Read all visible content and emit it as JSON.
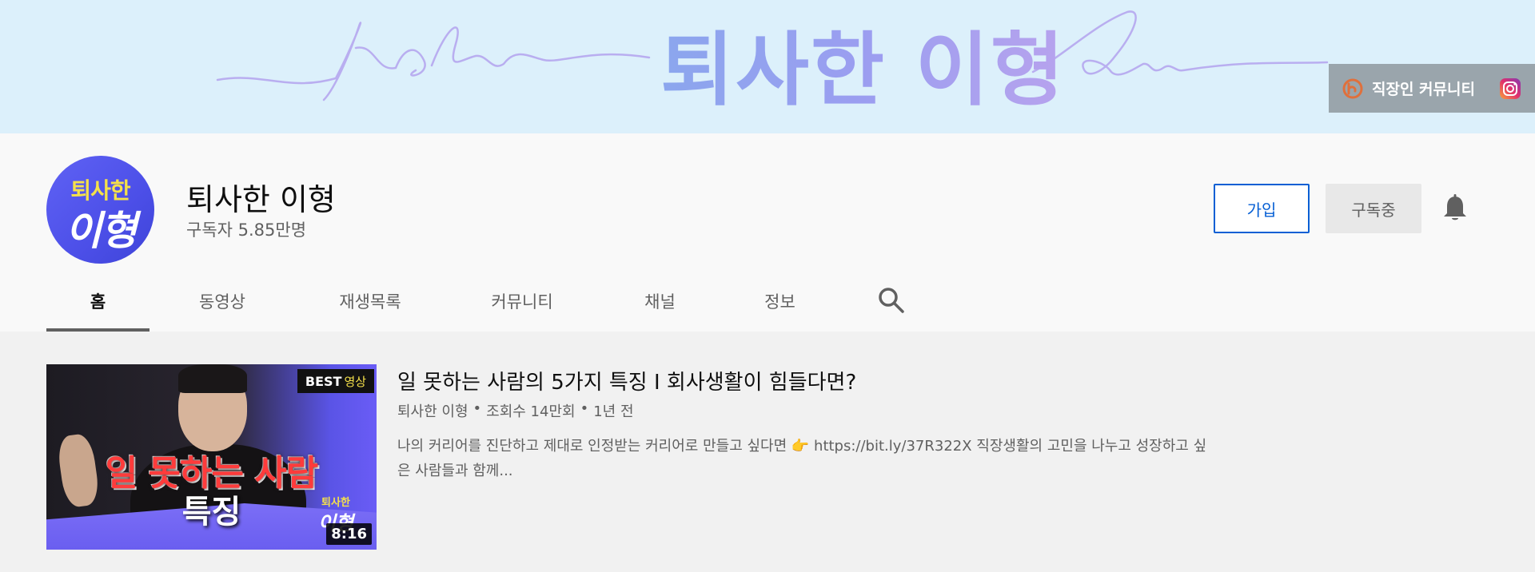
{
  "banner": {
    "script_left": "joshua",
    "title": "퇴사한 이형",
    "script_right": "lee",
    "link_label": "직장인 커뮤니티",
    "link_icon": "community-link-icon",
    "social_icon": "instagram-icon"
  },
  "channel": {
    "avatar_top": "퇴사한",
    "avatar_bottom": "이형",
    "name": "퇴사한 이형",
    "subscribers": "구독자 5.85만명",
    "join_label": "가입",
    "subscribed_label": "구독중"
  },
  "tabs": [
    {
      "label": "홈",
      "active": true
    },
    {
      "label": "동영상"
    },
    {
      "label": "재생목록"
    },
    {
      "label": "커뮤니티"
    },
    {
      "label": "채널"
    },
    {
      "label": "정보"
    }
  ],
  "featured": {
    "badge_best": "BEST",
    "badge_video": "영상",
    "thumb_line1": "일 못하는 사람",
    "thumb_line2": "특징",
    "thumb_logo_top": "퇴사한",
    "thumb_logo_bottom": "이형",
    "duration": "8:16",
    "title": "일 못하는 사람의 5가지 특징 I 회사생활이 힘들다면?",
    "meta": {
      "channel": "퇴사한 이형",
      "views": "조회수 14만회",
      "age": "1년 전"
    },
    "description_1": "나의 커리어를 진단하고 제대로 인정받는 커리어로 만들고 싶다면 👉 ",
    "description_url": "https://bit.ly/37R322X",
    "description_2": " 직장생활의 고민을 나누고 성장하고 싶은 사람들과 함께..."
  },
  "colors": {
    "banner_bg": "#dcf0fb",
    "avatar": "#5256ec",
    "accent_blue": "#065fd4"
  }
}
